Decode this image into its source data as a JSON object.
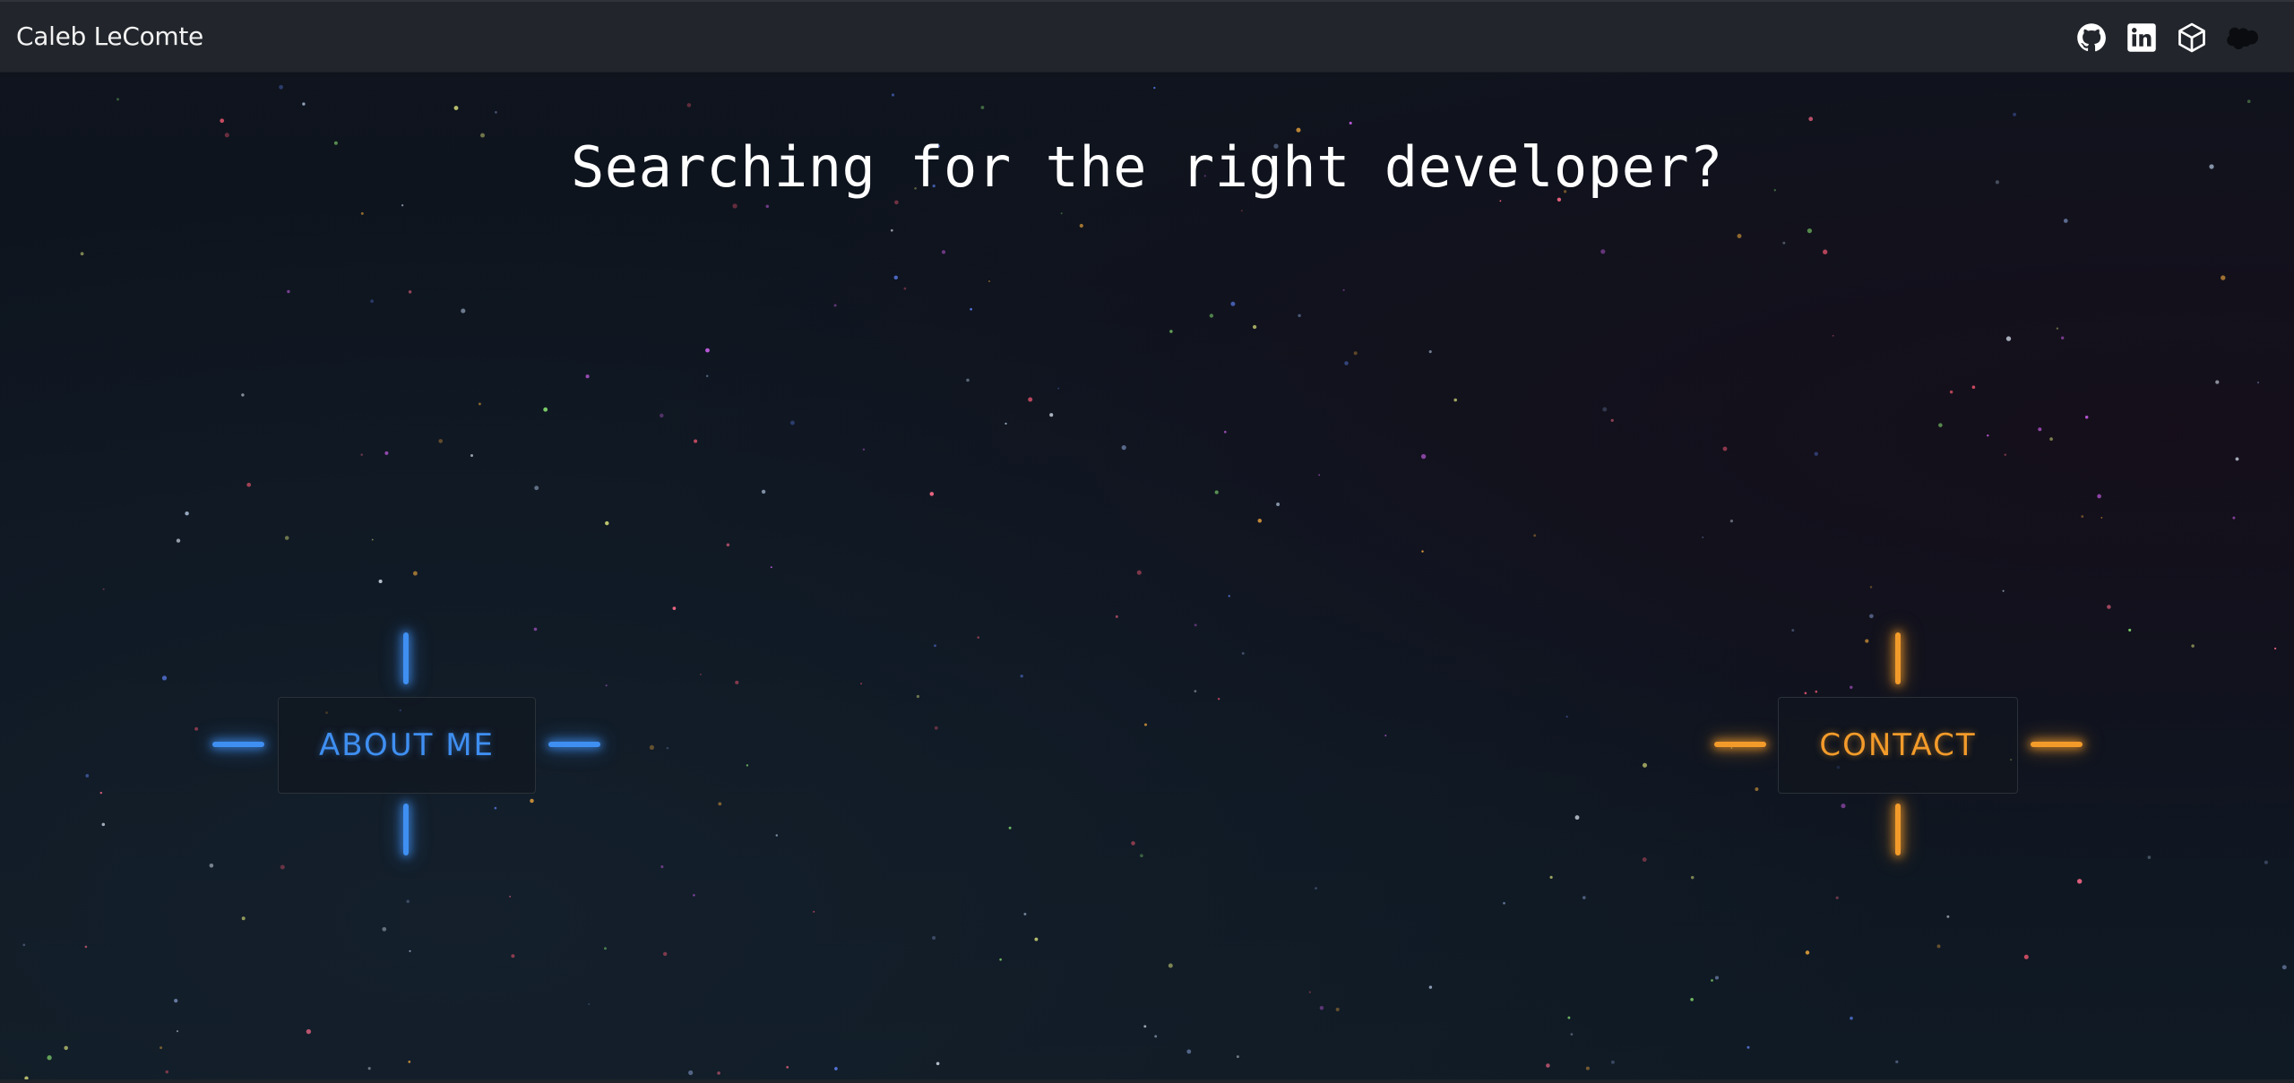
{
  "navbar": {
    "brand": "Caleb LeComte",
    "icons": [
      "github-icon",
      "linkedin-icon",
      "cube-icon",
      "salesforce-icon"
    ]
  },
  "hero": {
    "headline": "Searching for the right developer?"
  },
  "buttons": {
    "about": "ABOUT ME",
    "contact": "CONTACT"
  },
  "colors": {
    "background": "#0d121c",
    "navbar": "#22262c",
    "about_accent": "#3f8ff2",
    "contact_accent": "#f39b2a"
  }
}
